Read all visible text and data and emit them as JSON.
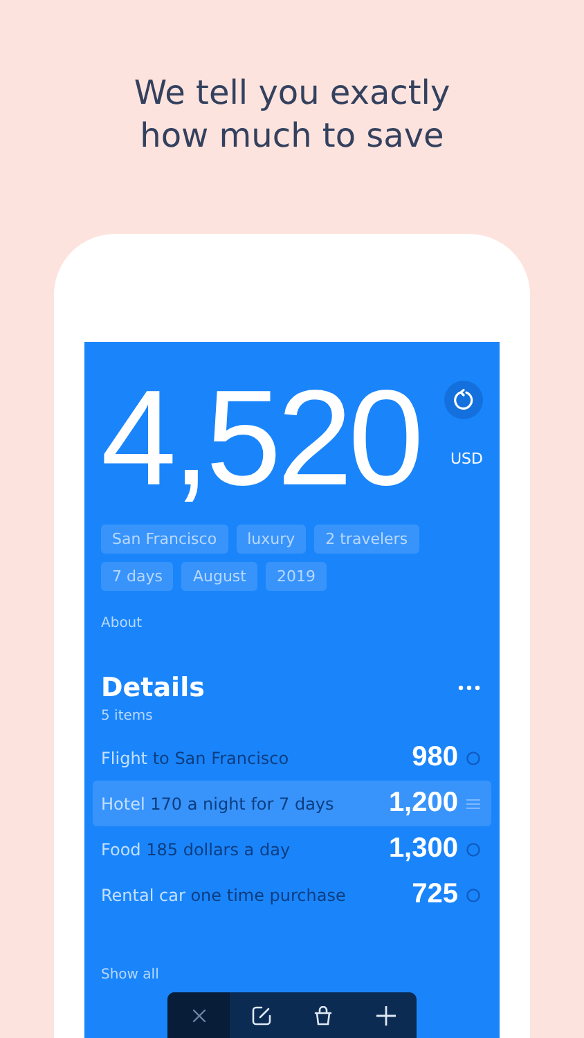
{
  "headline": [
    "We tell you exactly",
    "how much to save"
  ],
  "total": {
    "amount": "4,520",
    "currency": "USD"
  },
  "tags": [
    "San Francisco",
    "luxury",
    "2 travelers",
    "7 days",
    "August",
    "2019"
  ],
  "about": "About",
  "details": {
    "title": "Details",
    "count": "5 items",
    "items": [
      {
        "name": "Flight",
        "note": "to San Francisco",
        "amount": "980",
        "selected": false
      },
      {
        "name": "Hotel",
        "note": "170 a night for 7 days",
        "amount": "1,200",
        "selected": true
      },
      {
        "name": "Food",
        "note": "185 dollars a day",
        "amount": "1,300",
        "selected": false
      },
      {
        "name": "Rental car",
        "note": "one time purchase",
        "amount": "725",
        "selected": false
      }
    ],
    "show_all": "Show all"
  }
}
